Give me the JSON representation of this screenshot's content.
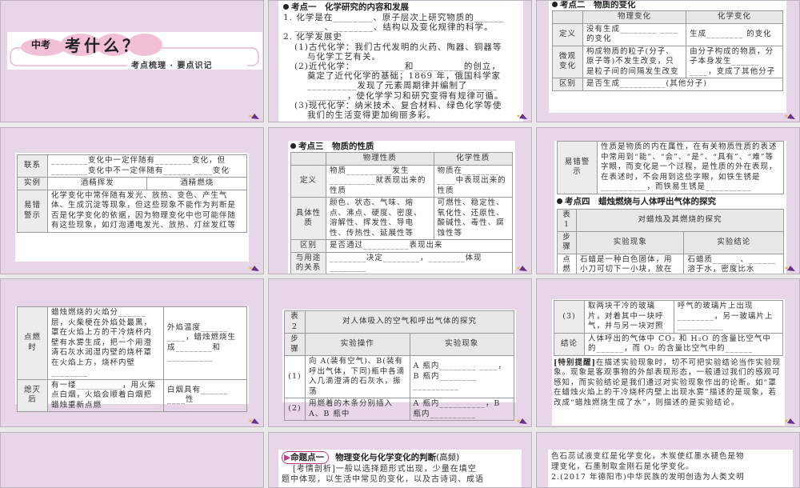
{
  "slides": {
    "s1": {
      "prefix": "中考",
      "title": "考什么？",
      "subtitle": "考点梳理 · 要点识记"
    },
    "s2": {
      "heading": "考点一　化学研究的内容和发展",
      "lines": [
        "1. 化学是在________、原子层次上研究物质的______",
        "______、________、结构以及变化规律的科学。",
        "2. 化学发展史",
        "(1)古代化学：我们古代发明的火药、陶器、铜器等",
        "与化学工艺有关。",
        "(2)近代化学：__________和__________的创立，",
        "奠定了近代化学的基础；1869 年，俄国科学家",
        "__________发现了元素周期律并编制了______",
        "________，使化学学习和研究变得有规律可循。",
        "(3)现代化学：纳米技术、复合材料、绿色化学等使",
        "我们的生活变得更加绚丽多彩。"
      ]
    },
    "s3": {
      "heading": "考点二　物质的变化",
      "col1": "物理变化",
      "col2": "化学变化",
      "rows": [
        [
          "定义",
          "没有生成________ ____的变化",
          "生成________ 的变化"
        ],
        [
          "微观变化",
          "构成物质的粒子(分子、原子等)不发生改变，只是粒子间的间隔发生改变",
          "由分子构成的物质，分子本身发生______ ____，变成了其他分子"
        ],
        [
          "区别",
          "是否生成__________(其他分子)",
          ""
        ]
      ]
    },
    "s4": {
      "rows": [
        [
          "联系",
          "________变化中一定伴随有________变化，但________变化中不一定伴随有______ ____变化"
        ],
        [
          "实例",
          "酒精挥发",
          "酒精燃烧"
        ],
        [
          "易错警示",
          "化学变化中常伴随有发光、放热、变色、产生气体、生成沉淀等现象，但这些现象不能作为判断是否是化学变化的依据，因为物理变化中也可能伴随有这些现象，如灯泡通电发光、放热、灯丝发红等"
        ]
      ]
    },
    "s5": {
      "heading": "考点三　物质的性质",
      "col1": "物理性质",
      "col2": "化学性质",
      "rows": [
        [
          "定义",
          "物质__________发生__________就表现出来的性质",
          "物质在________ ____中表现出来的性质"
        ],
        [
          "具体性质",
          "颜色、状态、气味、熔点、沸点、硬度、密度、溶解性、挥发性、导电性、传热性、延展性等",
          "可燃性、稳定性、氧化性、还原性、酸碱性、毒性、腐蚀性等"
        ],
        [
          "区别",
          "是否通过__________表现出来",
          ""
        ],
        [
          "与用途的关系",
          "________决定________，________体现________",
          ""
        ]
      ]
    },
    "s6": {
      "warn_label": "易错警示",
      "warn_text": "性质是物质的内在属性，在有关物质性质的表述中常用到“能”、“会”、“是”、“具有”、“难”等字眼，而变化是一个过程，是性质的外在表现，在表述时，不会用到这些字眼，如铁生锈是__________，而铁易生锈是__________",
      "heading": "考点四　蜡烛燃烧与人体呼出气体的探究",
      "table_no": "表 1",
      "table_title": "对蜡烛及其燃烧的探究",
      "step": "步骤",
      "col1": "实验现象",
      "col2": "实验结论",
      "rows": [
        [
          "点燃前",
          "石蜡是一种白色固体，用小刀可切下一小块，放在水中浮在水面",
          "石蜡质______、______溶于水，密度比水______"
        ]
      ]
    },
    "s7": {
      "rows": [
        [
          "点燃时",
          "蜡烛燃烧的火焰分______层，火柴梗在外焰处最黑，罩在火焰上方的干冷烧杯内壁有水雾生成，把一个用澄清石灰水润湿内壁的烧杯罩在火焰上方，烧杯内壁________",
          "外焰温度______ ____，蜡烛燃烧生成________和__________"
        ],
        [
          "熄灭后",
          "有一缕__________，用火柴点白烟，火焰会顺着白烟把蜡烛重新点燃",
          "白烟具有______ ____性"
        ]
      ]
    },
    "s8": {
      "table_no": "表 2",
      "table_title": "对人体吸入的空气和呼出气体的探究",
      "step": "步骤",
      "col1": "实验操作",
      "col2": "实验现象",
      "rows": [
        [
          "(1)",
          "向 A(装有空气)、B(装有呼出气体，下同)瓶中各滴入几滴澄清的石灰水，振荡",
          "A 瓶内________ ____，B 瓶内________ __________"
        ],
        [
          "(2)",
          "用燃着的木条分别插入 A、B 瓶中",
          "A 瓶内__________，B 瓶内__________"
        ]
      ]
    },
    "s9": {
      "rows": [
        [
          "(3)",
          "取两块干冷的玻璃片，对着其中一块呼气，并与另一块对照",
          "呼气的玻璃片上出现________，另一玻璃片上__________"
        ],
        [
          "结论",
          "人体呼出的气体中 CO₂ 和 H₂O 的含量比空气中的______，而 O₂ 的含量比空气中的______"
        ]
      ],
      "tip_label": "[特别提醒]",
      "tip_text": "在描述实验现象时，切不可把实验结论当作实验现象。现象是客观事物的外部表现形态，一般通过我们的感观可感知，而实验结论是我们通过对实验现象作出的论断。如“罩在蜡烛火焰上的干冷烧杯内壁上出现水雾”描述的是现象，若改成“蜡烛燃烧生成了水”，则描述的是实验结论。"
    },
    "s11": {
      "badge": "命题点一",
      "heading": "物理变化与化学变化的判断",
      "freq": "(高频)",
      "lines": [
        "[考情剖析]一般以选择题形式出现，少量在填空",
        "题中体现，以生活中常见的变化，以及古诗词、成语"
      ]
    },
    "s12": {
      "lines": [
        "色石蕊试液变红是化学变化，木炭使红墨水褪色是物",
        "理变化，石墨制取金刚石是化学变化。",
        "2.(2017 年德阳市)中华民族的发明创造为人类文明"
      ]
    }
  },
  "colors": {
    "slide_bg": "#e6d6e7",
    "gap": "#ebeaeb",
    "accent": "#7a3d8f",
    "pink": "#f0bcd4"
  }
}
